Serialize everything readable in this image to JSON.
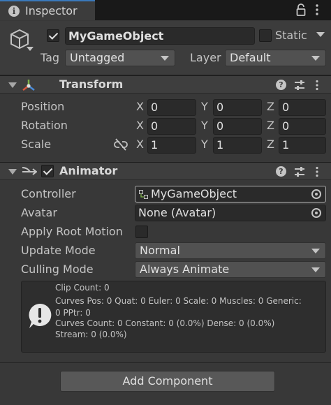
{
  "tab": {
    "title": "Inspector",
    "info_icon": "info-icon",
    "lock_icon": "lock-icon",
    "menu_icon": "kebab-menu-icon"
  },
  "header": {
    "object_icon": "cube-icon",
    "active": true,
    "name": "MyGameObject",
    "static_label": "Static",
    "static_checked": false,
    "tag_label": "Tag",
    "tag_value": "Untagged",
    "layer_label": "Layer",
    "layer_value": "Default"
  },
  "transform": {
    "title": "Transform",
    "icon": "transform-axes-icon",
    "rows": [
      {
        "label": "Position",
        "x": "0",
        "y": "0",
        "z": "0"
      },
      {
        "label": "Rotation",
        "x": "0",
        "y": "0",
        "z": "0"
      },
      {
        "label": "Scale",
        "x": "1",
        "y": "1",
        "z": "1"
      }
    ],
    "axes": {
      "x": "X",
      "y": "Y",
      "z": "Z"
    },
    "scale_link_icon": "unlinked-chain-icon"
  },
  "animator": {
    "title": "Animator",
    "icon": "animator-icon",
    "enabled": true,
    "controller_label": "Controller",
    "controller_value": "MyGameObject",
    "avatar_label": "Avatar",
    "avatar_value": "None (Avatar)",
    "apply_root_motion_label": "Apply Root Motion",
    "apply_root_motion": false,
    "update_mode_label": "Update Mode",
    "update_mode_value": "Normal",
    "culling_mode_label": "Culling Mode",
    "culling_mode_value": "Always Animate",
    "info": [
      "Clip Count: 0",
      "Curves Pos: 0 Quat: 0 Euler: 0 Scale: 0 Muscles: 0 Generic:",
      "0 PPtr: 0",
      "Curves Count: 0 Constant: 0 (0.0%) Dense: 0 (0.0%)",
      "Stream: 0 (0.0%)"
    ]
  },
  "add_component_label": "Add Component",
  "colors": {
    "accent": "#3a79bb",
    "panel": "#383838",
    "field": "#2a2a2a"
  }
}
